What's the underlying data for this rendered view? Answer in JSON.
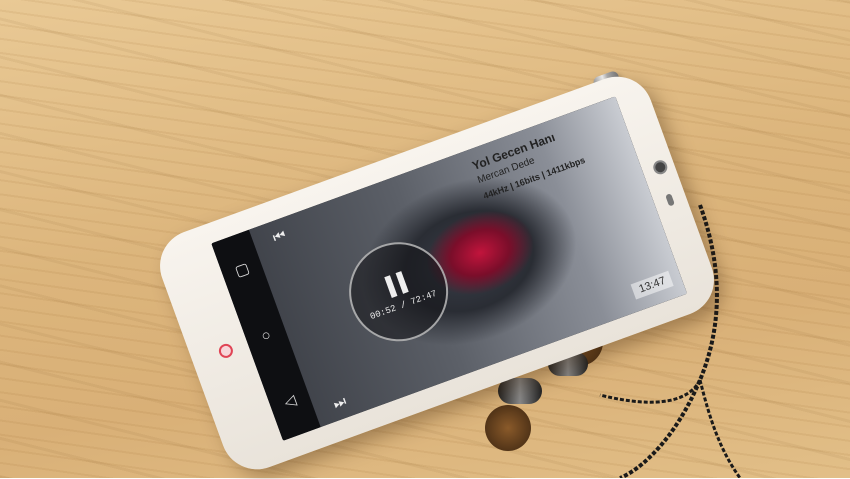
{
  "scene": {
    "table": "wooden-desk",
    "phone": "white-smartphone",
    "accessory": "in-ear-earphones"
  },
  "screen": {
    "track_title": "Yol Gecen Hanı",
    "track_artist": "Mercan Dede",
    "format": "44kHz | 16bits | 1411kbps",
    "playback_time": "00:52 / 72:47",
    "side_time": "13:47",
    "nav_buttons": [
      "▢",
      "○",
      "◁"
    ]
  },
  "colors": {
    "wood": "#dcb57c",
    "phone_body": "#f3eee7",
    "art_accent": "#c2143c"
  }
}
